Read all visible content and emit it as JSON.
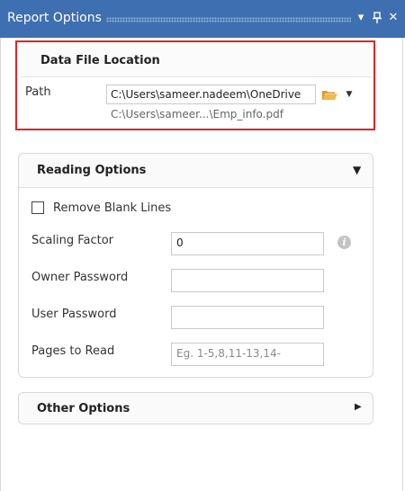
{
  "window": {
    "title": "Report Options",
    "icons": {
      "dropdown": "chevron-down-icon",
      "pin": "pin-icon",
      "close": "close-icon"
    }
  },
  "data_file_location": {
    "title": "Data File Location",
    "path_label": "Path",
    "path_value": "C:\\Users\\sameer.nadeem\\OneDrive",
    "path_short": "C:\\Users\\sameer...\\Emp_info.pdf"
  },
  "reading_options": {
    "title": "Reading Options",
    "remove_blank_lines": {
      "label": "Remove Blank Lines",
      "checked": false
    },
    "scaling_factor": {
      "label": "Scaling Factor",
      "value": "0"
    },
    "owner_password": {
      "label": "Owner Password",
      "value": ""
    },
    "user_password": {
      "label": "User Password",
      "value": ""
    },
    "pages_to_read": {
      "label": "Pages to Read",
      "placeholder": "Eg. 1-5,8,11-13,14-"
    }
  },
  "other_options": {
    "title": "Other Options"
  },
  "colors": {
    "titlebar": "#3e6fb0",
    "highlight_border": "#d62828",
    "folder_icon": "#f2a93b"
  }
}
